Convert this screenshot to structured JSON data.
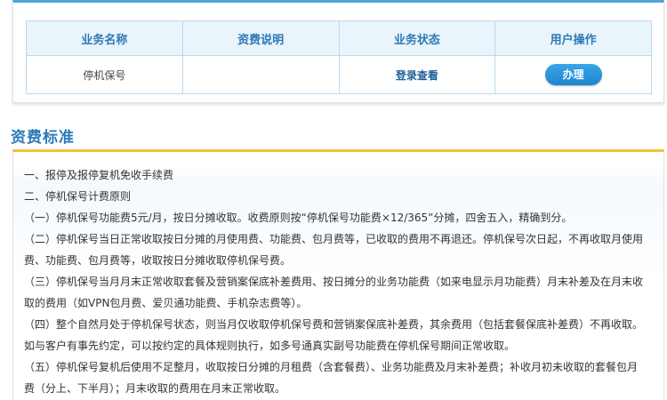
{
  "table": {
    "headers": [
      "业务名称",
      "资费说明",
      "业务状态",
      "用户操作"
    ],
    "row": {
      "name": "停机保号",
      "fee_desc": "",
      "status": "登录查看",
      "action": "办理"
    }
  },
  "section": {
    "title": "资费标准"
  },
  "rules": [
    "一、报停及报停复机免收手续费",
    "二、停机保号计费原则",
    "（一）停机保号功能费5元/月，按日分摊收取。收费原则按“停机保号功能费×12/365”分摊，四舍五入，精确到分。",
    "（二）停机保号当日正常收取按日分摊的月使用费、功能费、包月费等，已收取的费用不再退还。停机保号次日起，不再收取月使用费、功能费、包月费等，收取按日分摊收取停机保号费。",
    "（三）停机保号当月月末正常收取套餐及营销案保底补差费用、按日摊分的业务功能费（如来电显示月功能费）月末补差及在月末收取的费用（如VPN包月费、爱贝通功能费、手机杂志费等）。",
    "（四）整个自然月处于停机保号状态，则当月仅收取停机保号费和营销案保底补差费，其余费用（包括套餐保底补差费）不再收取。如与客户有事先约定，可以按约定的具体规则执行，如多号通真实副号功能费在停机保号期间正常收取。",
    "（五）停机保号复机后使用不足整月，收取按日分摊的月租费（含套餐费）、业务功能费及月末补差费；补收月初未收取的套餐包月费（分上、下半月）；月末收取的费用在月末正常收取。"
  ],
  "colors": {
    "accent_blue": "#2b7ab8",
    "top_border_blue": "#4fa3d8",
    "section_border_yellow": "#f1c232",
    "button_blue": "#1d86cf"
  }
}
